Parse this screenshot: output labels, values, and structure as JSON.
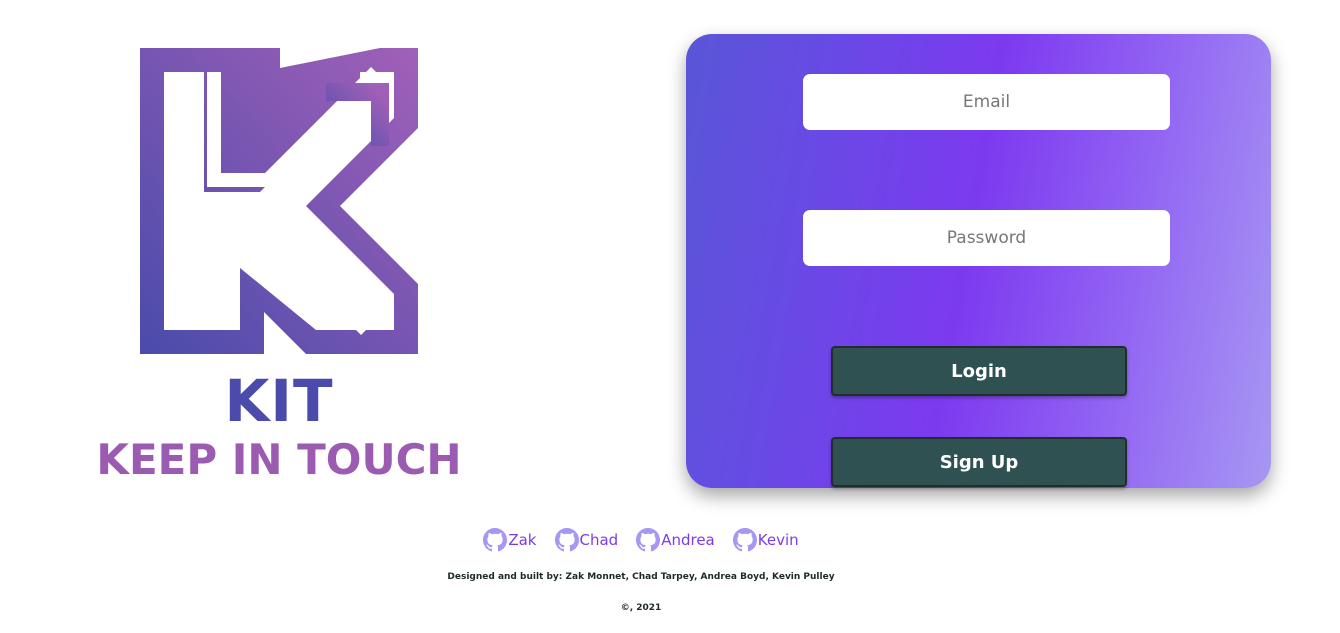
{
  "logo": {
    "title": "KIT",
    "tagline": "KEEP IN TOUCH",
    "icon": "kit-k-logo",
    "colors": {
      "start": "#4a4bab",
      "end": "#a160b8"
    }
  },
  "login_form": {
    "email_placeholder": "Email",
    "password_placeholder": "Password",
    "login_label": "Login",
    "signup_label": "Sign Up",
    "gradient_colors": [
      "#5956d7",
      "#7c3aef",
      "#a797f3"
    ],
    "button_color": "#2f5151"
  },
  "footer": {
    "github_links": [
      {
        "label": "Zak",
        "icon": "github-icon"
      },
      {
        "label": "Chad",
        "icon": "github-icon"
      },
      {
        "label": "Andrea",
        "icon": "github-icon"
      },
      {
        "label": "Kevin",
        "icon": "github-icon"
      }
    ],
    "credits": "Designed and built by: Zak Monnet, Chad Tarpey, Andrea Boyd, Kevin Pulley",
    "copyright": "©, 2021",
    "link_color": "#7c3aef"
  }
}
